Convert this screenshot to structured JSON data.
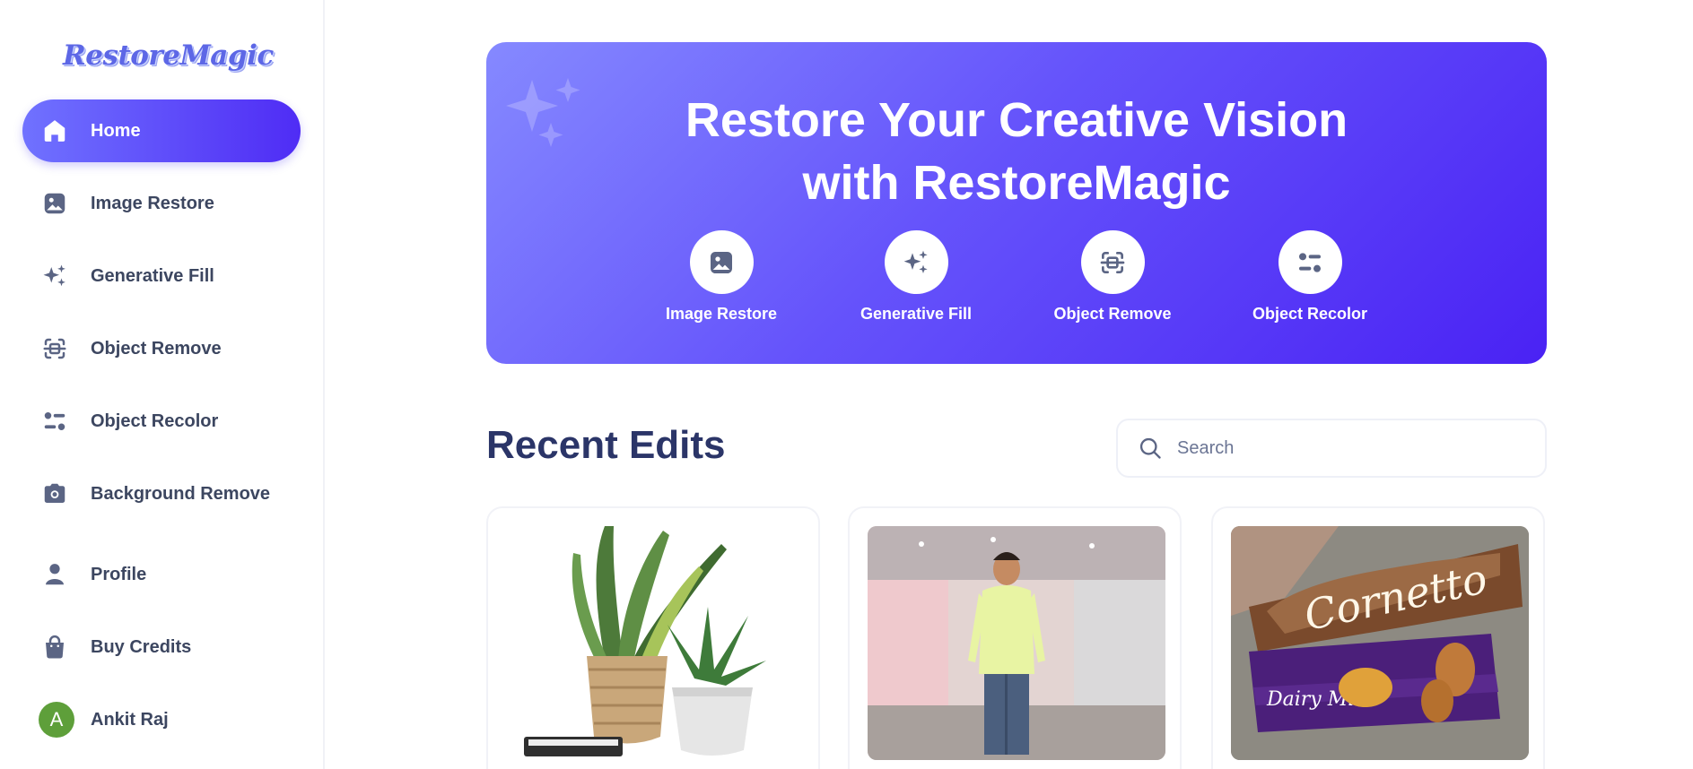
{
  "app": {
    "logo_text": "RestoreMagic"
  },
  "sidebar": {
    "items": [
      {
        "label": "Home",
        "icon": "home-icon",
        "active": true
      },
      {
        "label": "Image Restore",
        "icon": "image-icon"
      },
      {
        "label": "Generative Fill",
        "icon": "sparkle-icon"
      },
      {
        "label": "Object Remove",
        "icon": "scan-remove-icon"
      },
      {
        "label": "Object Recolor",
        "icon": "recolor-icon"
      },
      {
        "label": "Background Remove",
        "icon": "camera-icon"
      },
      {
        "label": "Profile",
        "icon": "user-icon"
      },
      {
        "label": "Buy Credits",
        "icon": "shopping-bag-icon"
      }
    ],
    "user": {
      "initial": "A",
      "name": "Ankit Raj",
      "avatar_color": "#5e9f3a"
    }
  },
  "hero": {
    "title": "Restore Your Creative Vision with RestoreMagic",
    "tools": [
      {
        "label": "Image Restore",
        "icon": "image-icon"
      },
      {
        "label": "Generative Fill",
        "icon": "sparkle-icon"
      },
      {
        "label": "Object Remove",
        "icon": "scan-remove-icon"
      },
      {
        "label": "Object Recolor",
        "icon": "recolor-icon"
      }
    ]
  },
  "recent": {
    "title": "Recent Edits",
    "search_placeholder": "Search",
    "cards": [
      {
        "subject": "potted plants"
      },
      {
        "subject": "man in yellow shirt"
      },
      {
        "subject": "chocolate snacks"
      }
    ]
  },
  "colors": {
    "accent_start": "#7072ff",
    "accent_end": "#4f2cf5",
    "heading": "#2b3568",
    "nav_text": "#3c4660",
    "icon": "#5b6584"
  }
}
